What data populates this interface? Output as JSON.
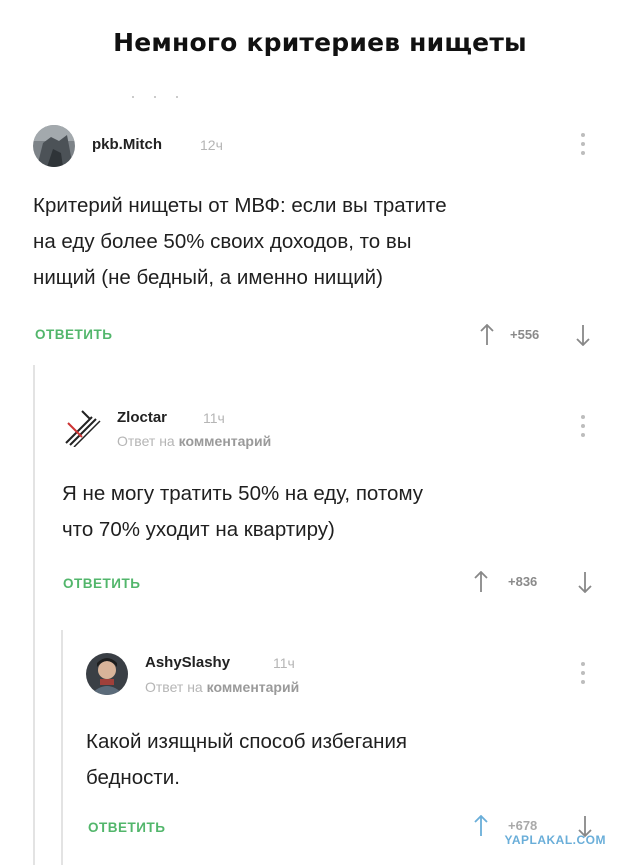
{
  "title": "Немного критериев нищеты",
  "comments": [
    {
      "author": "pkb.Mitch",
      "time": "12ч",
      "text_lines": [
        "Критерий нищеты от МВФ: если вы тратите",
        "на еду более 50% своих доходов, то вы",
        "нищий (не бедный, а именно нищий)"
      ],
      "reply_label": "ОТВЕТИТЬ",
      "score": "+556"
    },
    {
      "author": "Zloctar",
      "time": "11ч",
      "reply_prefix": "Ответ на",
      "reply_target": "комментарий",
      "text_lines": [
        "Я не могу тратить 50% на еду, потому",
        "что  70% уходит на квартиру)"
      ],
      "reply_label": "ОТВЕТИТЬ",
      "score": "+836"
    },
    {
      "author": "AshySlashy",
      "time": "11ч",
      "reply_prefix": "Ответ на",
      "reply_target": "комментарий",
      "text_lines": [
        "Какой изящный способ избегания",
        "бедности."
      ],
      "reply_label": "ОТВЕТИТЬ",
      "score": "+678"
    }
  ],
  "watermark": "YAPLAKAL.COM",
  "colors": {
    "accent_green": "#52b66b",
    "muted_gray": "#b5b5b5",
    "thread_line": "#e3e3e3"
  }
}
